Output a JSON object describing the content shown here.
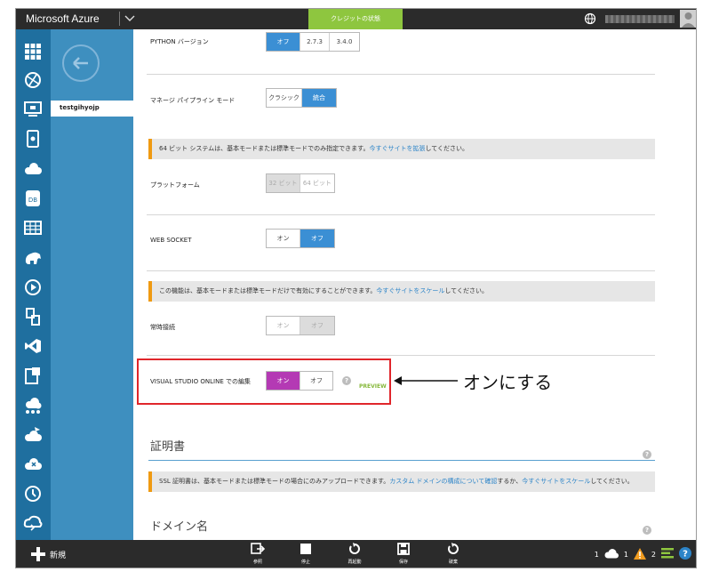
{
  "header": {
    "brand": "Microsoft Azure",
    "credit_status": "クレジットの状態"
  },
  "subnav": {
    "site_name": "testgihyojp"
  },
  "settings": {
    "python": {
      "label": "PYTHON バージョン",
      "options": [
        "オフ",
        "2.7.3",
        "3.4.0"
      ],
      "selected": "オフ"
    },
    "pipeline": {
      "label": "マネージ パイプライン モード",
      "options": [
        "クラシック",
        "統合"
      ],
      "selected": "統合"
    },
    "notice_64bit": {
      "text": "64 ビット システムは、基本モードまたは標準モードでのみ指定できます。",
      "link": "今すぐサイトを拡張",
      "suffix": "してください。"
    },
    "platform": {
      "label": "プラットフォーム",
      "options": [
        "32 ビット",
        "64 ビット"
      ],
      "selected": "32 ビット"
    },
    "websocket": {
      "label": "WEB SOCKET",
      "options": [
        "オン",
        "オフ"
      ],
      "selected": "オフ"
    },
    "notice_feature": {
      "text": "この機能は、基本モードまたは標準モードだけで有効にすることができます。",
      "link": "今すぐサイトをスケール",
      "suffix": "してください。"
    },
    "always_on": {
      "label": "常時接続",
      "options": [
        "オン",
        "オフ"
      ],
      "selected": "オフ"
    },
    "vs_online": {
      "label": "VISUAL STUDIO ONLINE での編集",
      "options": [
        "オン",
        "オフ"
      ],
      "selected": "オン",
      "preview": "PREVIEW"
    },
    "certificates": {
      "title": "証明書",
      "notice_text": "SSL 証明書は、基本モードまたは標準モードの場合にのみアップロードできます。",
      "notice_link1": "カスタム ドメインの構成について確認",
      "notice_mid": "するか、",
      "notice_link2": "今すぐサイトをスケール",
      "notice_suffix": "してください。"
    },
    "domains": {
      "title": "ドメイン名"
    }
  },
  "annotation": {
    "text": "オンにする"
  },
  "bottombar": {
    "new_label": "新規",
    "commands": [
      {
        "label": "参照",
        "icon": "browse-icon"
      },
      {
        "label": "停止",
        "icon": "stop-icon"
      },
      {
        "label": "再起動",
        "icon": "restart-icon"
      },
      {
        "label": "保存",
        "icon": "save-icon"
      },
      {
        "label": "破棄",
        "icon": "discard-icon"
      }
    ],
    "status": {
      "cloud_count": "1",
      "warning_count": "1",
      "list_count": "2"
    }
  },
  "colors": {
    "accent_blue": "#3b8fd4",
    "rail": "#1f6f9f",
    "subnav": "#3e8fbf",
    "credit_green": "#8ec63f",
    "vs_on": "#b43ab4",
    "highlight_red": "#e0262b",
    "notice_orange": "#ef9a12"
  }
}
